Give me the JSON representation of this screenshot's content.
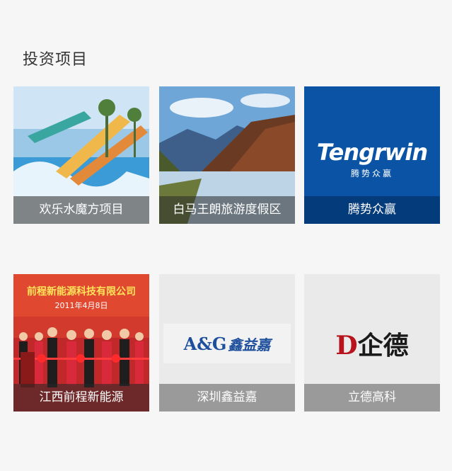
{
  "section": {
    "title": "投资项目"
  },
  "projects": [
    {
      "name": "欢乐水魔方项目"
    },
    {
      "name": "白马王朗旅游度假区"
    },
    {
      "name": "腾势众赢",
      "logo_latin": "Tengrwin",
      "logo_cn": "腾势众赢",
      "brand_color": "#0a53a5"
    },
    {
      "name": "江西前程新能源",
      "banner_text": "前程新能源科技有限公司",
      "banner_date": "2011年4月8日"
    },
    {
      "name": "深圳鑫益嘉",
      "logo_latin": "A&G",
      "logo_cn": "鑫益嘉",
      "brand_color": "#1d4f9c"
    },
    {
      "name": "立德高科",
      "logo_mark": "D",
      "logo_cn": "企德",
      "brand_color": "#b8141d"
    }
  ]
}
